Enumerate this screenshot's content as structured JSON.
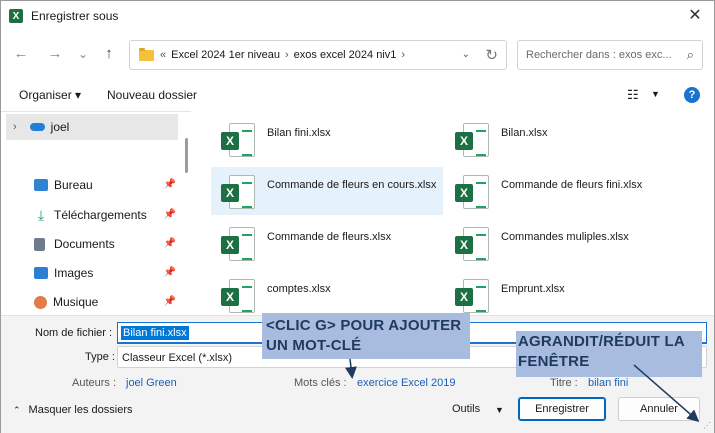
{
  "window": {
    "title": "Enregistrer sous",
    "app_icon": "excel-icon",
    "close_glyph": "✕"
  },
  "nav": {
    "back_glyph": "←",
    "forward_glyph": "→",
    "recent_glyph": "⌄",
    "up_glyph": "↑",
    "breadcrumb_overflow": "«",
    "path": [
      "Excel 2024 1er niveau",
      "exos excel 2024 niv1"
    ],
    "path_separator": "›",
    "refresh_glyph": "↻",
    "search_placeholder": "Rechercher dans : exos exc...",
    "search_glyph": "⌕"
  },
  "toolbar": {
    "organize_label": "Organiser ▾",
    "new_folder_label": "Nouveau dossier",
    "view_glyph": "☷",
    "view_chevron": "▼",
    "help_glyph": "?"
  },
  "sidebar": {
    "user": {
      "label": "joel",
      "expand_glyph": "›"
    },
    "pin_glyph": "📌",
    "items": [
      {
        "label": "Bureau",
        "icon": "desktop-icon",
        "color": "#2f83d0"
      },
      {
        "label": "Téléchargements",
        "icon": "download-icon",
        "color": "#1f9b6f"
      },
      {
        "label": "Documents",
        "icon": "documents-icon",
        "color": "#6d7c8c"
      },
      {
        "label": "Images",
        "icon": "images-icon",
        "color": "#2a7fd4"
      },
      {
        "label": "Musique",
        "icon": "music-icon",
        "color": "#e07c4a"
      }
    ]
  },
  "files": [
    {
      "name": "Bilan fini.xlsx"
    },
    {
      "name": "Bilan.xlsx"
    },
    {
      "name": "Commande de fleurs en cours.xlsx",
      "selected": true
    },
    {
      "name": "Commande de fleurs fini.xlsx"
    },
    {
      "name": "Commande de fleurs.xlsx"
    },
    {
      "name": "Commandes muliples.xlsx"
    },
    {
      "name": "comptes.xlsx"
    },
    {
      "name": "Emprunt.xlsx"
    }
  ],
  "form": {
    "filename_label": "Nom de fichier :",
    "filename_value": "Bilan fini.xlsx",
    "type_label": "Type :",
    "type_value": "Classeur Excel (*.xlsx)",
    "authors_label": "Auteurs :",
    "authors_value": "joel Green",
    "keywords_label": "Mots clés :",
    "keywords_value": "exercice Excel 2019",
    "title_label": "Titre :",
    "title_value": "bilan fini",
    "hide_folders_label": "Masquer les dossiers",
    "hide_folders_glyph": "⌃",
    "tools_label": "Outils",
    "tools_glyph": "▼",
    "save_label": "Enregistrer",
    "cancel_label": "Annuler",
    "grip_glyph": "⋰"
  },
  "annotations": {
    "keyword_callout": "<CLIC G> POUR AJOUTER UN MOT-CLÉ",
    "resize_callout": "AGRANDIT/RÉDUIT LA FENÊTRE"
  },
  "colors": {
    "accent": "#0067c0",
    "excel_green": "#1d7044",
    "callout_bg": "#a8bce0",
    "callout_text": "#1f3a5f"
  }
}
